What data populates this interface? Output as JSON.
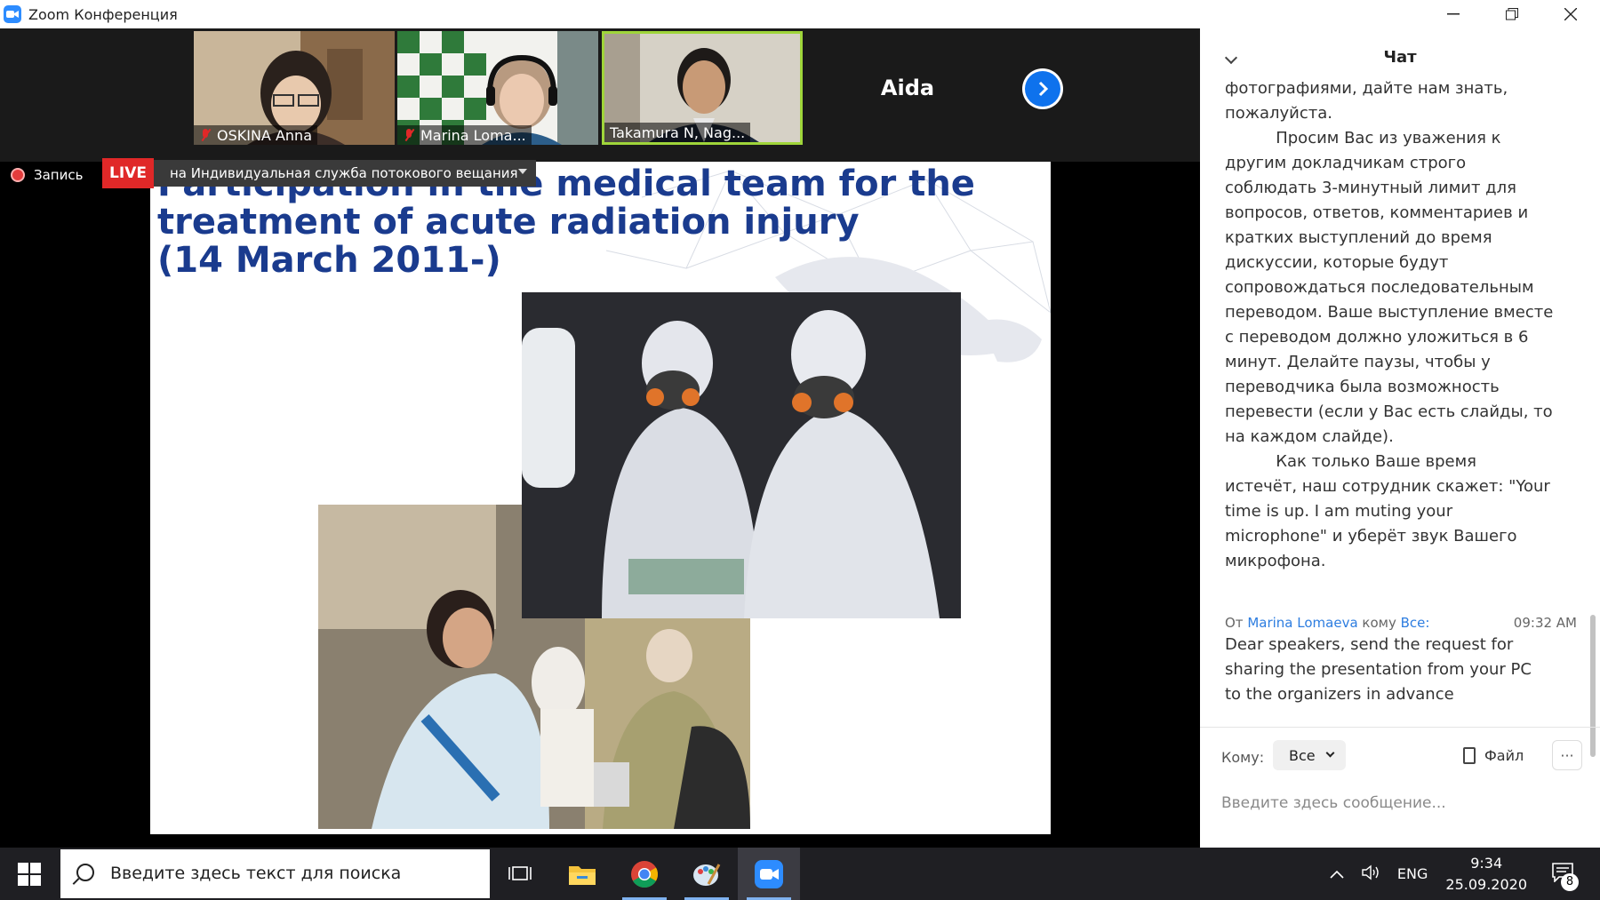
{
  "window": {
    "title": "Zoom Конференция"
  },
  "participants": [
    {
      "name": "OSKINA Anna",
      "muted": true
    },
    {
      "name": "Marina Loma...",
      "muted": true
    },
    {
      "name": "Takamura N, Nag...",
      "muted": false,
      "active_speaker": true
    },
    {
      "name": "Aida",
      "muted": true
    }
  ],
  "recording": {
    "label": "Запись",
    "live_badge": "LIVE",
    "stream_text": "на Индивидуальная служба потокового вещания"
  },
  "slide": {
    "title_lines": [
      "Participation in the medical team for the",
      "treatment of  acute radiation injury",
      "(14 March 2011-)"
    ],
    "title_color": "#1a3b8e"
  },
  "chat": {
    "title": "Чат",
    "message1_text": "фотографиями, дайте нам знать,\nпожалуйста.\n          Просим Вас из уважения к\nдругим докладчикам строго\nсоблюдать 3-минутный лимит для\nвопросов, ответов, комментариев и\nкратких выступлений до время\nдискуссии, которые будут\nсопровождаться последовательным\nпереводом. Ваше выступление вместе\nс переводом должно уложиться в 6\nминут. Делайте паузы, чтобы у\nпереводчика была возможность\nперевести (если у Вас есть слайды, то\nна каждом слайде).\n          Как только Ваше время\nистечёт, наш сотрудник скажет: \"Your\ntime is up. I am muting your\nmicrophone\" и уберёт звук Вашего\nмикрофона.",
    "message2": {
      "from_prefix": "От",
      "sender": "Marina Lomaeva",
      "to_prefix": "кому",
      "recipient": "Все:",
      "time": "09:32 AM",
      "text": "Dear speakers, send the request for\nsharing the presentation from your PC\nto the organizers in advance"
    },
    "to_label": "Кому:",
    "to_value": "Все",
    "file_label": "Файл",
    "more_label": "···",
    "input_placeholder": "Введите здесь сообщение..."
  },
  "taskbar": {
    "search_placeholder": "Введите здесь текст для поиска",
    "language": "ENG",
    "time": "9:34",
    "date": "25.09.2020",
    "notification_count": "8"
  },
  "colors": {
    "zoom_blue": "#2d8cff",
    "live_red": "#e02828",
    "chat_link": "#2d7de0"
  }
}
